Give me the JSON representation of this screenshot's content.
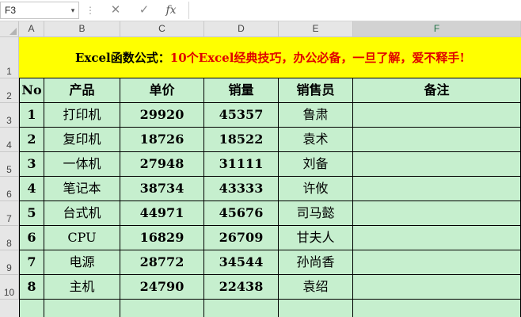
{
  "formula_bar": {
    "name_box": "F3",
    "name_box_arrow": "▾",
    "dots": "⋮",
    "cancel_glyph": "✕",
    "confirm_glyph": "✓",
    "fx_label": "fx",
    "formula": ""
  },
  "columns": [
    "A",
    "B",
    "C",
    "D",
    "E",
    "F"
  ],
  "rows": [
    "1",
    "2",
    "3",
    "4",
    "5",
    "6",
    "7",
    "8",
    "9",
    "10"
  ],
  "title": {
    "part1": "Excel函数公式：",
    "part2": "10个Excel经典技巧，办公必备，一旦了解，爱不释手!"
  },
  "table": {
    "headers": [
      "No",
      "产品",
      "单价",
      "销量",
      "销售员",
      "备注"
    ],
    "rows": [
      [
        "1",
        "打印机",
        "29920",
        "45357",
        "鲁肃",
        ""
      ],
      [
        "2",
        "复印机",
        "18726",
        "18522",
        "袁术",
        ""
      ],
      [
        "3",
        "一体机",
        "27948",
        "31111",
        "刘备",
        ""
      ],
      [
        "4",
        "笔记本",
        "38734",
        "43333",
        "许攸",
        ""
      ],
      [
        "5",
        "台式机",
        "44971",
        "45676",
        "司马懿",
        ""
      ],
      [
        "6",
        "CPU",
        "16829",
        "26709",
        "甘夫人",
        ""
      ],
      [
        "7",
        "电源",
        "28772",
        "34544",
        "孙尚香",
        ""
      ],
      [
        "8",
        "主机",
        "24790",
        "22438",
        "袁绍",
        ""
      ]
    ]
  },
  "colors": {
    "title_fill": "#ffff00",
    "title_red": "#e00000",
    "table_fill": "#c6efce",
    "header_bg": "#e6e6e6"
  }
}
